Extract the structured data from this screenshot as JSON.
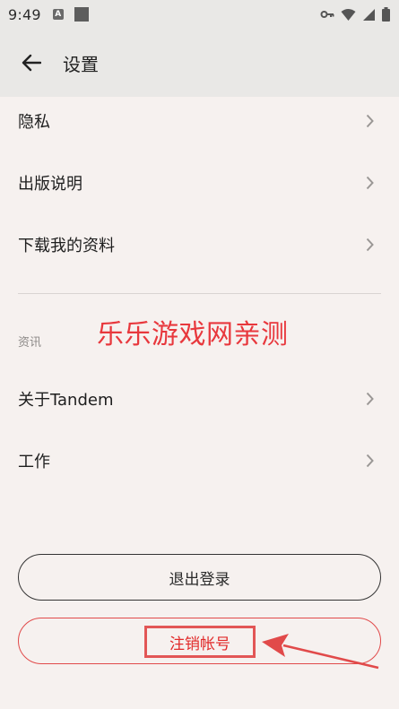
{
  "status_bar": {
    "time": "9:49",
    "notif_badge": "A"
  },
  "header": {
    "title": "设置"
  },
  "rows": [
    {
      "label": "隐私"
    },
    {
      "label": "出版说明"
    },
    {
      "label": "下载我的资料"
    }
  ],
  "section": {
    "header": "资讯",
    "rows": [
      {
        "label": "关于Tandem"
      },
      {
        "label": "工作"
      }
    ]
  },
  "watermark": "乐乐游戏网亲测",
  "buttons": {
    "logout": "退出登录",
    "delete_account": "注销帐号"
  },
  "colors": {
    "background": "#f6f1ef",
    "app_bar": "#e9e8e6",
    "annotation_red": "#e14a4a"
  }
}
